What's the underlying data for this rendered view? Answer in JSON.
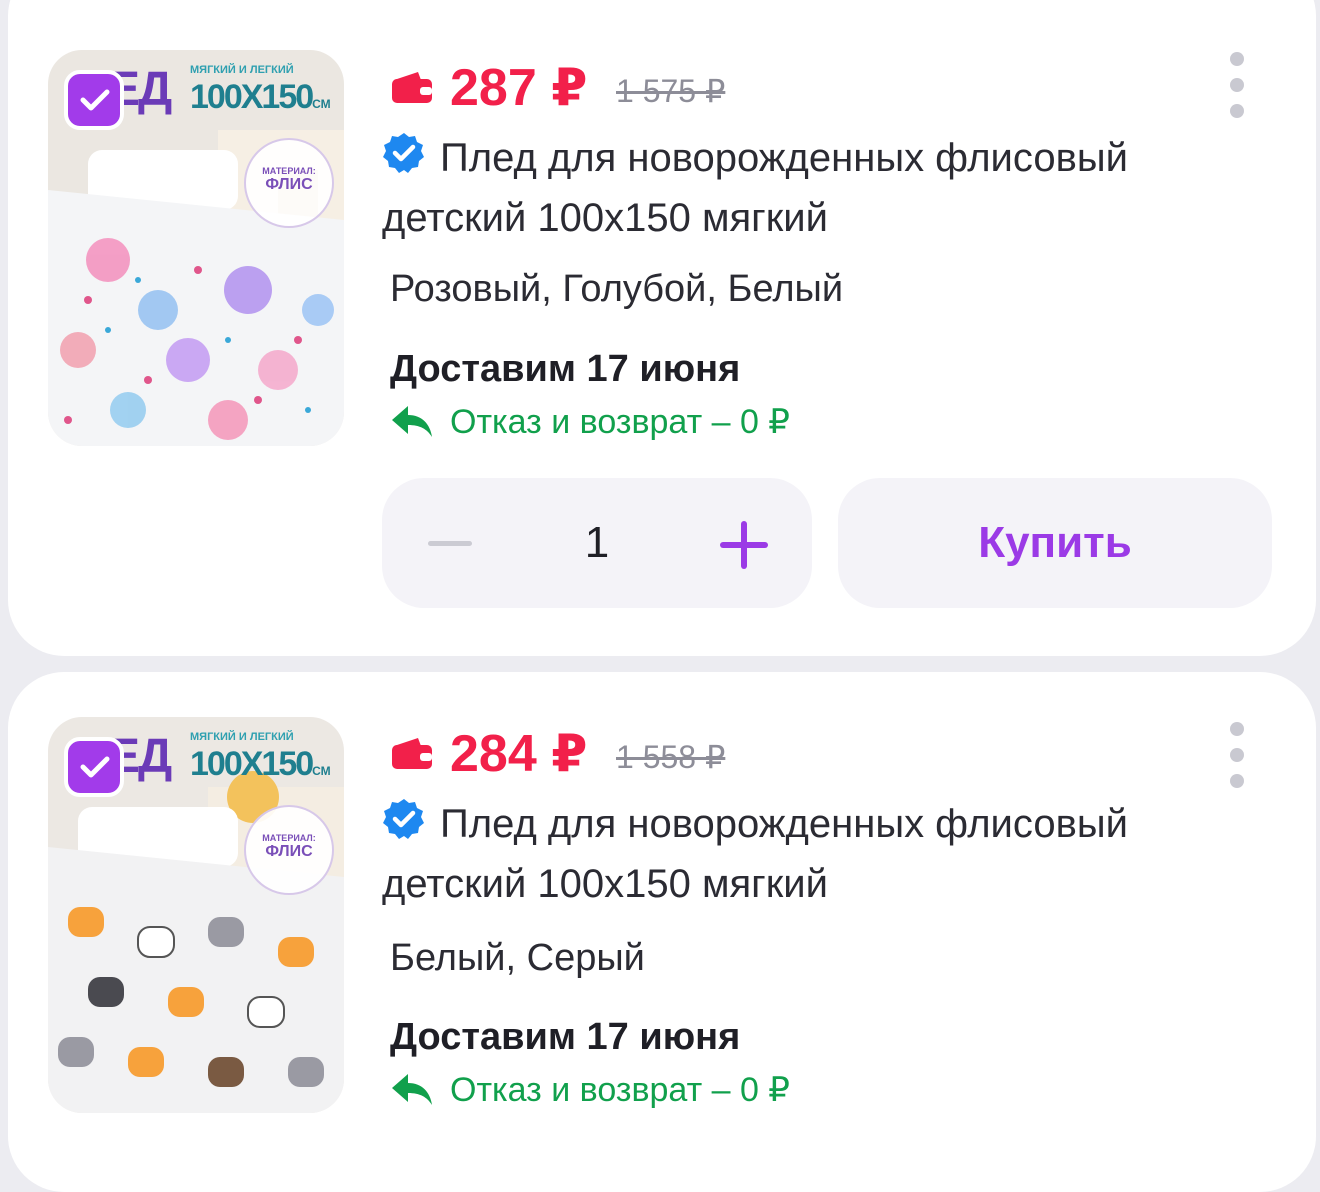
{
  "colors": {
    "price": "#f2204a",
    "accent": "#9b3ae6",
    "return_green": "#11a04c",
    "verified_blue": "#1e88f0"
  },
  "products": [
    {
      "price": "287 ₽",
      "old_price": "1 575 ₽",
      "title": "Плед для новорожденных флисовый детский 100х150 мягкий",
      "colors": "Розовый, Голубой, Белый",
      "delivery": "Доставим 17 июня",
      "return_policy": "Отказ и возврат – 0 ₽",
      "quantity": "1",
      "buy_label": "Купить",
      "selected": true,
      "image": {
        "badge_letters": "ЕД",
        "badge_subtitle": "МЯГКИЙ И ЛЕГКИЙ",
        "badge_size": "100Х150",
        "badge_unit": "СМ",
        "material_label": "МАТЕРИАЛ:",
        "material_value": "ФЛИС",
        "pattern": "ballerinas"
      }
    },
    {
      "price": "284 ₽",
      "old_price": "1 558 ₽",
      "title": "Плед для новорожденных флисовый детский 100х150 мягкий",
      "colors": "Белый, Серый",
      "delivery": "Доставим 17 июня",
      "return_policy": "Отказ и возврат – 0 ₽",
      "selected": true,
      "image": {
        "badge_letters": "ЕД",
        "badge_subtitle": "МЯГКИЙ И ЛЕГКИЙ",
        "badge_size": "100Х150",
        "badge_unit": "СМ",
        "material_label": "МАТЕРИАЛ:",
        "material_value": "ФЛИС",
        "pattern": "cats"
      }
    }
  ],
  "icons": {
    "wallet": "wallet-icon",
    "verified": "verified-icon",
    "return": "return-arrow-icon",
    "more": "more-vertical-icon",
    "check": "checkmark-icon"
  }
}
